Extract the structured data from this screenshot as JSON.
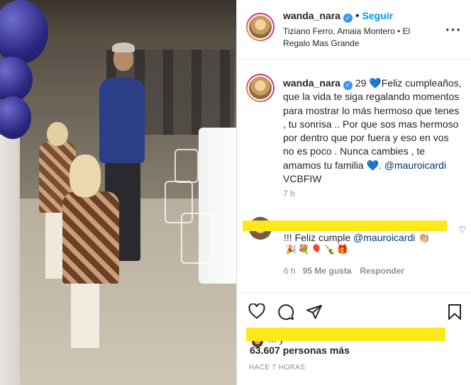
{
  "post": {
    "username": "wanda_nara",
    "follow_label": "Seguir",
    "music": "Tiziano Ferro, Amaia Montero • El Regalo Mas Grande",
    "more_icon": "more-horizontal-icon"
  },
  "caption": {
    "username": "wanda_nara",
    "text_a": "29 ",
    "text_b": "Feliz cumpleaños, que la vida te siga regalando momentos para mostrar lo más hermoso que tenes , tu sonrisa .. Por que sos mas hermoso por dentro que por fuera y eso en vos no es poco . Nunca cambies , te amamos tu familia ",
    "text_c": ". ",
    "mention": "@mauroicardi",
    "text_d": " VCBFIW",
    "time": "7 h"
  },
  "comment": {
    "text_a": "!!! Feliz cumple ",
    "mention": "@mauroicardi",
    "text_b": " 👏🏼",
    "emojis": "🎉💐🎈🍾🎁",
    "time": "6 h",
    "likes": "95 Me gusta",
    "reply_label": "Responder"
  },
  "actions": {
    "like_icon": "heart-outline-icon",
    "comment_icon": "comment-icon",
    "share_icon": "share-icon",
    "save_icon": "bookmark-icon"
  },
  "likes": {
    "cut_text": "... y",
    "count": "63.607 personas más"
  },
  "timestamp": "HACE 7 HORAS",
  "colors": {
    "link": "#0095f6",
    "mention": "#00376b",
    "highlight": "#ffe81a",
    "verified": "#3897f0"
  }
}
